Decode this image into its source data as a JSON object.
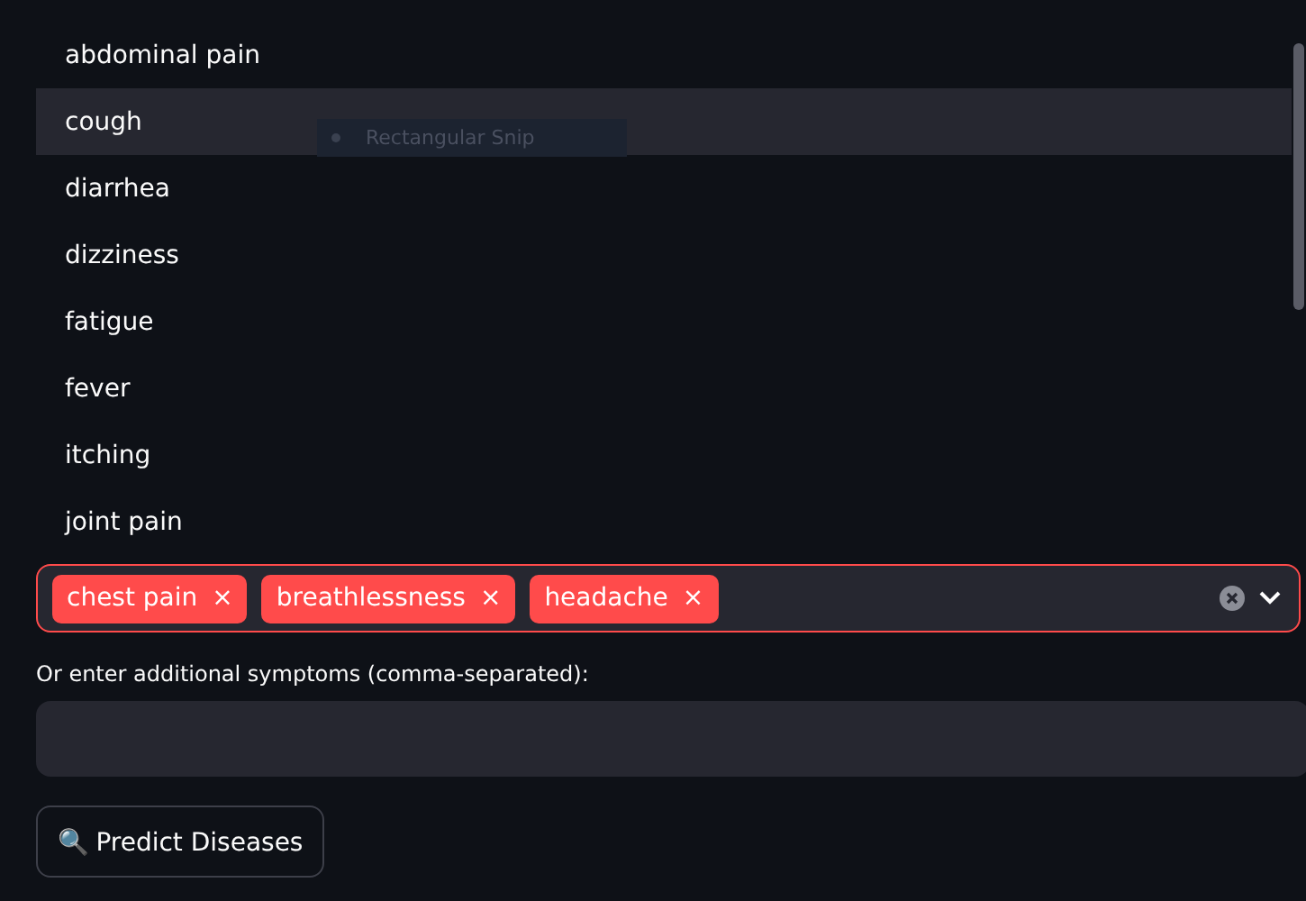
{
  "dropdown": {
    "options": [
      {
        "label": "abdominal pain",
        "selected": false
      },
      {
        "label": "cough",
        "selected": true
      },
      {
        "label": "diarrhea",
        "selected": false
      },
      {
        "label": "dizziness",
        "selected": false
      },
      {
        "label": "fatigue",
        "selected": false
      },
      {
        "label": "fever",
        "selected": false
      },
      {
        "label": "itching",
        "selected": false
      },
      {
        "label": "joint pain",
        "selected": false
      }
    ]
  },
  "tooltip": {
    "label": "Rectangular Snip"
  },
  "multiselect": {
    "tags": [
      {
        "label": "chest pain",
        "remove": "×"
      },
      {
        "label": "breathlessness",
        "remove": "×"
      },
      {
        "label": "headache",
        "remove": "×"
      }
    ]
  },
  "extra": {
    "label": "Or enter additional symptoms (comma-separated):"
  },
  "button": {
    "label": "🔍 Predict Diseases"
  }
}
